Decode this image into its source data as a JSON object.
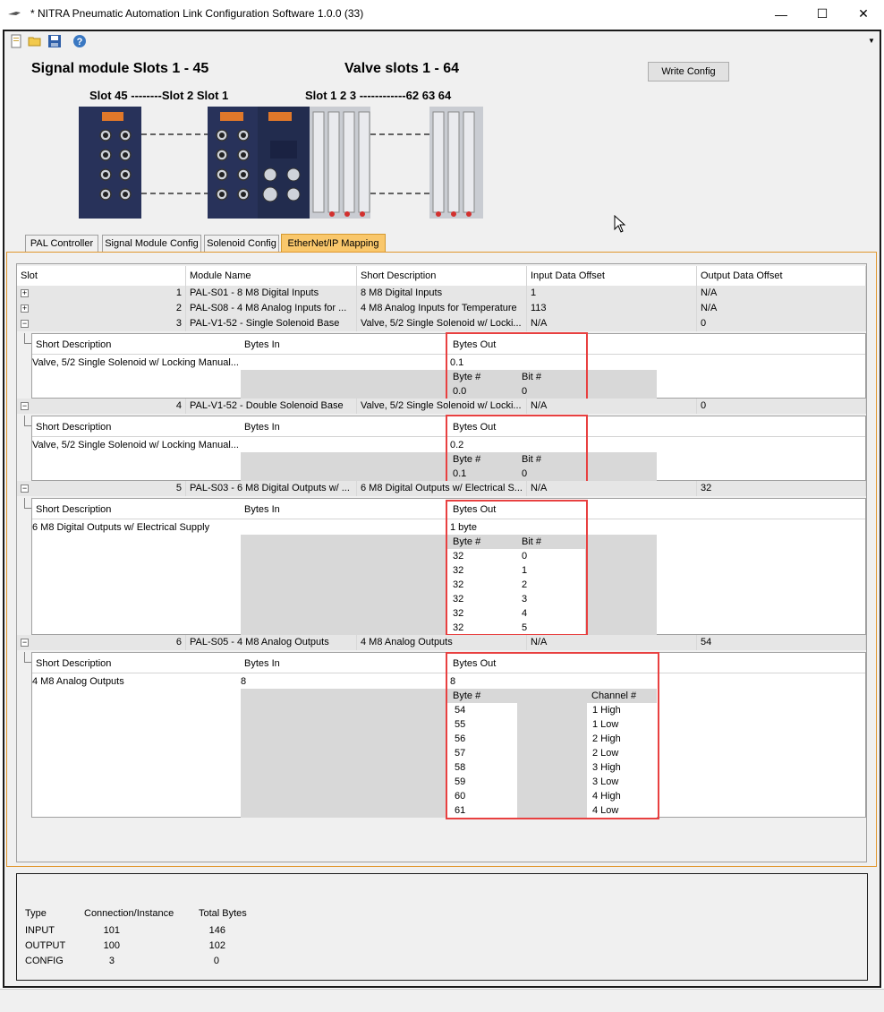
{
  "window": {
    "title": "* NITRA Pneumatic Automation Link Configuration Software 1.0.0 (33)",
    "minimize": "—",
    "maximize": "☐",
    "close": "✕"
  },
  "toolbar": {
    "icons": [
      "new-file-icon",
      "open-folder-icon",
      "save-icon",
      "help-icon"
    ]
  },
  "header": {
    "signal_heading": "Signal module Slots 1 - 45",
    "valve_heading": "Valve slots 1 - 64",
    "signal_slots": "Slot 45 --------Slot 2  Slot 1",
    "valve_slots": "Slot 1  2  3 ------------62 63 64",
    "write_config": "Write Config"
  },
  "tabs": [
    {
      "label": "PAL Controller"
    },
    {
      "label": "Signal Module Config"
    },
    {
      "label": "Solenoid Config"
    },
    {
      "label": "EtherNet/IP Mapping"
    }
  ],
  "grid": {
    "columns": [
      "Slot",
      "Module Name",
      "Short Description",
      "Input Data Offset",
      "Output Data Offset"
    ],
    "rows": [
      {
        "expander": "+",
        "slot": "1",
        "module": "PAL-S01 - 8 M8 Digital Inputs",
        "desc": "8 M8 Digital Inputs",
        "in": "1",
        "out": "N/A"
      },
      {
        "expander": "+",
        "slot": "2",
        "module": "PAL-S08 - 4 M8 Analog Inputs for ...",
        "desc": "4 M8 Analog Inputs for Temperature",
        "in": "113",
        "out": "N/A"
      },
      {
        "expander": "−",
        "slot": "3",
        "module": "PAL-V1-52 - Single Solenoid Base",
        "desc": "Valve, 5/2 Single Solenoid  w/ Locki...",
        "in": "N/A",
        "out": "0"
      },
      {
        "expander": "−",
        "slot": "4",
        "module": "PAL-V1-52 - Double Solenoid Base",
        "desc": "Valve, 5/2 Single Solenoid  w/ Locki...",
        "in": "N/A",
        "out": "0"
      },
      {
        "expander": "−",
        "slot": "5",
        "module": "PAL-S03 - 6 M8 Digital Outputs w/ ...",
        "desc": "6 M8 Digital Outputs w/ Electrical S...",
        "in": "N/A",
        "out": "32"
      },
      {
        "expander": "−",
        "slot": "6",
        "module": "PAL-S05 - 4 M8 Analog Outputs",
        "desc": "4 M8 Analog Outputs",
        "in": "N/A",
        "out": "54"
      }
    ]
  },
  "details": {
    "labels": {
      "short_desc": "Short Description",
      "bytes_in": "Bytes In",
      "bytes_out": "Bytes Out",
      "byte_no": "Byte #",
      "bit_no": "Bit #",
      "channel_no": "Channel #"
    },
    "slot3": {
      "desc": "Valve, 5/2 Single Solenoid  w/ Locking Manual...",
      "bytes_out": "0.1",
      "rows": [
        {
          "byte": "0.0",
          "bit": "0"
        }
      ]
    },
    "slot4": {
      "desc": "Valve, 5/2 Single Solenoid  w/ Locking Manual...",
      "bytes_out": "0.2",
      "rows": [
        {
          "byte": "0.1",
          "bit": "0"
        }
      ]
    },
    "slot5": {
      "desc": "6 M8 Digital Outputs w/ Electrical Supply",
      "bytes_out": "1 byte",
      "rows": [
        {
          "byte": "32",
          "bit": "0"
        },
        {
          "byte": "32",
          "bit": "1"
        },
        {
          "byte": "32",
          "bit": "2"
        },
        {
          "byte": "32",
          "bit": "3"
        },
        {
          "byte": "32",
          "bit": "4"
        },
        {
          "byte": "32",
          "bit": "5"
        }
      ]
    },
    "slot6": {
      "desc": "4 M8 Analog Outputs",
      "bytes_in": "8",
      "bytes_out": "8",
      "rows": [
        {
          "byte": "54",
          "channel": "1 High"
        },
        {
          "byte": "55",
          "channel": "1 Low"
        },
        {
          "byte": "56",
          "channel": "2 High"
        },
        {
          "byte": "57",
          "channel": "2 Low"
        },
        {
          "byte": "58",
          "channel": "3 High"
        },
        {
          "byte": "59",
          "channel": "3 Low"
        },
        {
          "byte": "60",
          "channel": "4 High"
        },
        {
          "byte": "61",
          "channel": "4 Low"
        }
      ]
    }
  },
  "summary": {
    "headers": [
      "Type",
      "Connection/Instance",
      "Total Bytes"
    ],
    "rows": [
      {
        "type": "INPUT",
        "instance": "101",
        "bytes": "146"
      },
      {
        "type": "OUTPUT",
        "instance": "100",
        "bytes": "102"
      },
      {
        "type": "CONFIG",
        "instance": "3",
        "bytes": "0"
      }
    ]
  },
  "colors": {
    "highlight_box": "#e84040",
    "active_tab": "#f9c76b",
    "tab_border": "#e0962d"
  }
}
